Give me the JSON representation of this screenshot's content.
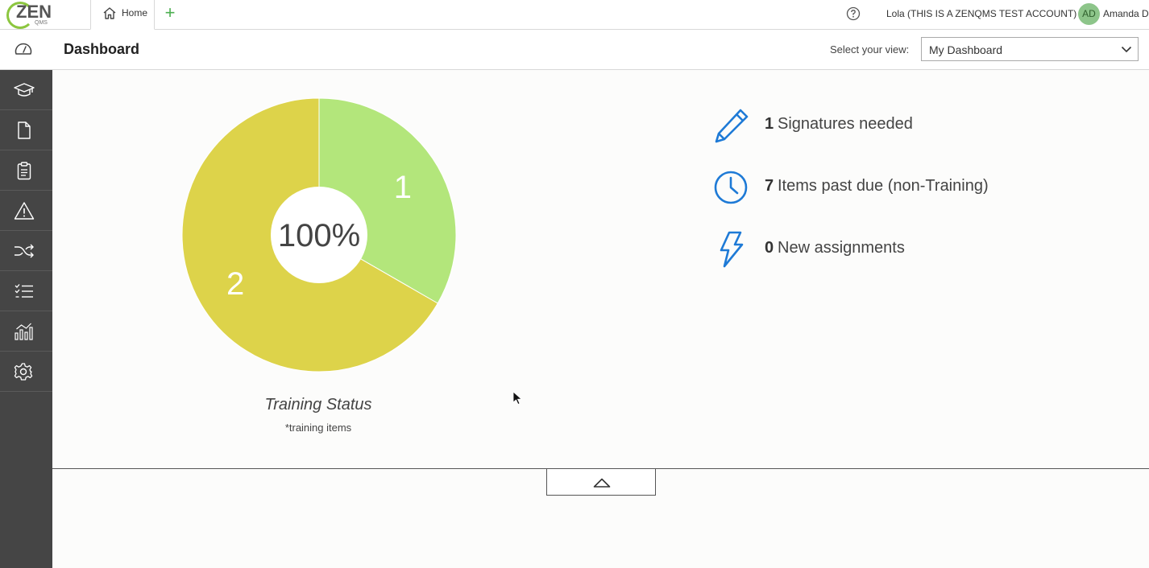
{
  "app": {
    "logo_text": "ZEN",
    "logo_sub": "QMS"
  },
  "topbar": {
    "home_tab_label": "Home",
    "add_tab_symbol": "+",
    "account_name": "Lola (THIS IS A ZENQMS TEST ACCOUNT)",
    "avatar_initials": "AD",
    "user_name": "Amanda D"
  },
  "header": {
    "title": "Dashboard",
    "view_label": "Select your view:",
    "view_selected": "My Dashboard"
  },
  "sidebar": {
    "items": [
      {
        "icon": "graduation-cap-icon"
      },
      {
        "icon": "document-icon"
      },
      {
        "icon": "clipboard-icon"
      },
      {
        "icon": "warning-icon"
      },
      {
        "icon": "shuffle-icon"
      },
      {
        "icon": "checklist-icon"
      },
      {
        "icon": "analytics-icon"
      },
      {
        "icon": "gear-icon"
      }
    ]
  },
  "training_chart": {
    "center_label": "100%",
    "title": "Training Status",
    "subtitle": "*training items"
  },
  "chart_data": {
    "type": "pie",
    "title": "Training Status",
    "subtitle": "*training items",
    "center_label": "100%",
    "slices": [
      {
        "label": "1",
        "value": 1,
        "color": "#b3e67b"
      },
      {
        "label": "2",
        "value": 2,
        "color": "#ddd34a"
      }
    ]
  },
  "stats": [
    {
      "icon": "pencil-icon",
      "count": "1",
      "label": "Signatures needed"
    },
    {
      "icon": "clock-icon",
      "count": "7",
      "label": "Items past due (non-Training)"
    },
    {
      "icon": "lightning-icon",
      "count": "0",
      "label": "New assignments"
    }
  ],
  "colors": {
    "accent_blue": "#1e7ad6",
    "sidebar_bg": "#454545",
    "logo_green": "#8cc63f"
  }
}
